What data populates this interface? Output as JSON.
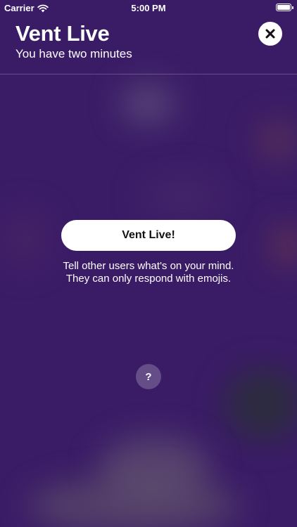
{
  "status_bar": {
    "carrier": "Carrier",
    "time": "5:00 PM",
    "icons": [
      "wifi-icon",
      "battery-icon"
    ]
  },
  "header": {
    "title": "Vent Live",
    "subtitle": "You have two minutes",
    "close_icon": "close-icon"
  },
  "main": {
    "vent_button_label": "Vent Live!",
    "description_line1": "Tell other users what's on your mind.",
    "description_line2": "They can only respond with emojis.",
    "help_label": "?"
  },
  "colors": {
    "background": "#3a1c66",
    "button_background": "#ffffff",
    "button_text": "#111111",
    "text": "#ffffff"
  }
}
